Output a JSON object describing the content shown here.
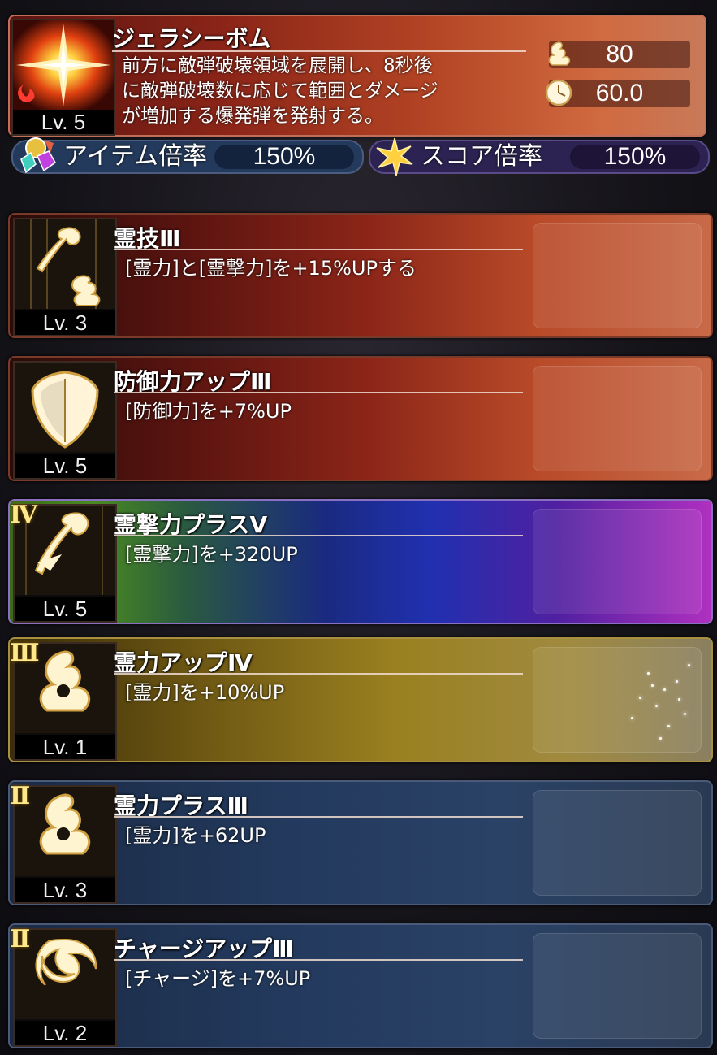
{
  "main_skill": {
    "name": "ジェラシーボム",
    "level": "Lv. 5",
    "description_lines": [
      "前方に敵弾破壊領域を展開し、8秒後",
      "に敵弾破壊数に応じて範囲とダメージ",
      "が増加する爆発弾を発射する。"
    ],
    "stat_power": "80",
    "stat_time": "60.0"
  },
  "bonus_bars": {
    "item_label": "アイテム倍率",
    "item_value": "150%",
    "score_label": "スコア倍率",
    "score_value": "150%"
  },
  "skills": [
    {
      "name": "霊技Ⅲ",
      "desc": "[霊力]と[霊撃力]を+15%UPする",
      "level": "Lv. 3",
      "rank": "",
      "style": "red",
      "icon": "spirit-attack-icon"
    },
    {
      "name": "防御力アップⅢ",
      "desc": "[防御力]を+7%UP",
      "level": "Lv. 5",
      "rank": "",
      "style": "red",
      "icon": "shield-icon"
    },
    {
      "name": "霊撃力プラスⅤ",
      "desc": "[霊撃力]を+320UP",
      "level": "Lv. 5",
      "rank": "Ⅳ",
      "style": "rainbow",
      "icon": "spirit-strike-icon"
    },
    {
      "name": "霊力アップⅣ",
      "desc": "[霊力]を+10%UP",
      "level": "Lv. 1",
      "rank": "Ⅲ",
      "style": "gold",
      "icon": "spirit-swirl-icon"
    },
    {
      "name": "霊力プラスⅢ",
      "desc": "[霊力]を+62UP",
      "level": "Lv. 3",
      "rank": "Ⅱ",
      "style": "blue",
      "icon": "spirit-swirl-icon"
    },
    {
      "name": "チャージアップⅢ",
      "desc": "[チャージ]を+7%UP",
      "level": "Lv. 2",
      "rank": "Ⅱ",
      "style": "blue",
      "icon": "charge-vortex-icon"
    }
  ]
}
